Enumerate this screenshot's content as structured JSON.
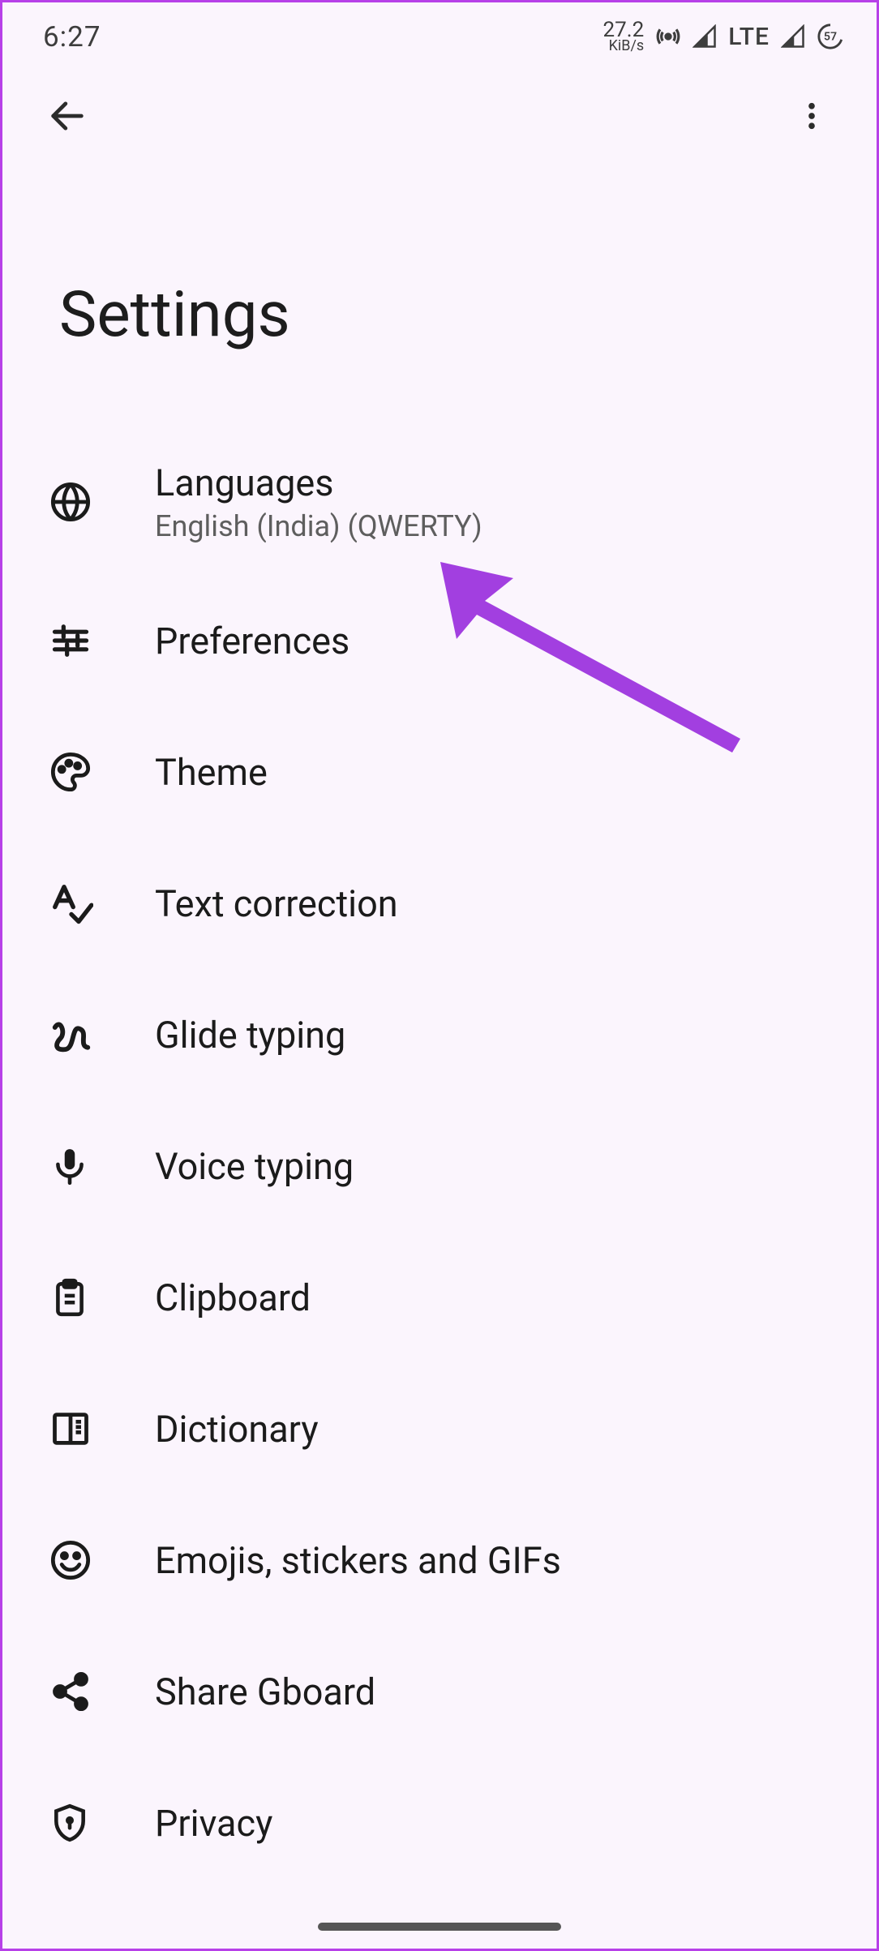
{
  "status_bar": {
    "time": "6:27",
    "net_speed_top": "27.2",
    "net_speed_bottom": "KiB/s",
    "network_label": "LTE",
    "battery_pct": "57"
  },
  "page": {
    "title": "Settings"
  },
  "items": [
    {
      "title": "Languages",
      "subtitle": "English (India) (QWERTY)"
    },
    {
      "title": "Preferences"
    },
    {
      "title": "Theme"
    },
    {
      "title": "Text correction"
    },
    {
      "title": "Glide typing"
    },
    {
      "title": "Voice typing"
    },
    {
      "title": "Clipboard"
    },
    {
      "title": "Dictionary"
    },
    {
      "title": "Emojis, stickers and GIFs"
    },
    {
      "title": "Share Gboard"
    },
    {
      "title": "Privacy"
    }
  ],
  "annotation": {
    "arrow_color": "#a23fe0"
  }
}
